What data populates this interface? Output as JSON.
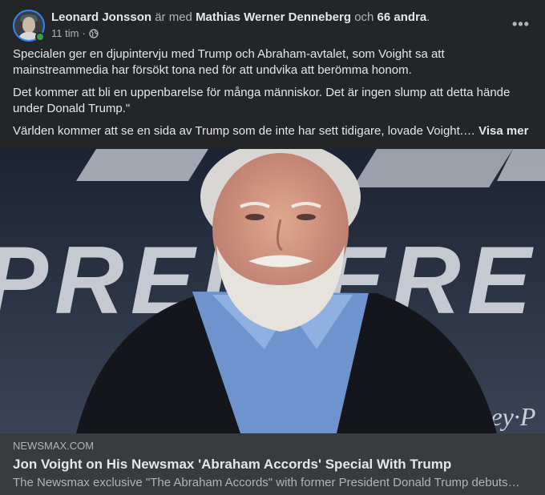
{
  "header": {
    "author": "Leonard Jonsson",
    "with_text": "är med",
    "tagged": "Mathias Werner Denneberg",
    "and_text": "och",
    "others": "66 andra",
    "period": ".",
    "time": "11 tim",
    "separator": "·",
    "audience_icon": "globe-icon",
    "more_label": "•••"
  },
  "post": {
    "paragraphs": [
      "Specialen ger en djupintervju med Trump och Abraham-avtalet, som Voight sa att mainstreammedia har försökt tona ned för att undvika att berömma honom.",
      "Det kommer att bli en uppenbarelse för många människor. Det är ingen slump att detta hände under Donald Trump.\"",
      "Världen kommer att se en sida av Trump som de inte har sett tidigare, lovade Voight.…"
    ],
    "see_more": "Visa mer"
  },
  "media": {
    "backdrop_text": "PREMIERE",
    "watermark": "Disney·P"
  },
  "link": {
    "domain": "NEWSMAX.COM",
    "title": "Jon Voight on His Newsmax 'Abraham Accords' Special With Trump",
    "description": "The Newsmax exclusive \"The Abraham Accords\" with former President Donald Trump debuts…"
  },
  "colors": {
    "background": "#242526",
    "link_box": "#3a3b3c",
    "text_primary": "#e4e6eb",
    "text_secondary": "#b0b3b8",
    "online": "#31a24c"
  }
}
